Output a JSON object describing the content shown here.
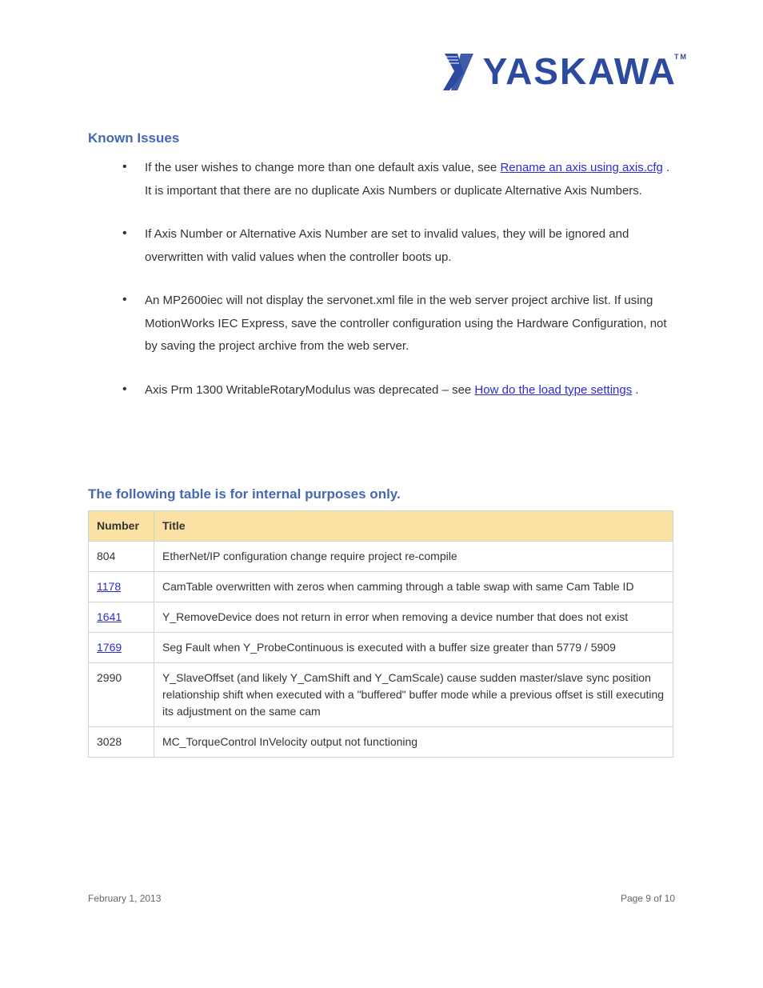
{
  "logo": {
    "text": "YASKAWA",
    "tm": "TM"
  },
  "headings": {
    "known_issues": "Known Issues",
    "table": "The following table is for internal purposes only."
  },
  "bullets": [
    {
      "pre": "If the user wishes to change more than one default axis value, see ",
      "link_text": "Rename an axis using axis.cfg",
      "post": ". It is important that there are no duplicate Axis Numbers or duplicate Alternative Axis Numbers."
    },
    {
      "pre": "If Axis Number or Alternative Axis Number are set to invalid values, they will be ignored and overwritten with valid values when the controller boots up.",
      "link_text": "",
      "post": ""
    },
    {
      "pre": "An MP2600iec will not display the servonet.xml file in the web server project archive list. If using MotionWorks IEC Express, save the controller configuration using the Hardware Configuration, not by saving the project archive from the web server.",
      "link_text": "",
      "post": ""
    },
    {
      "pre": "Axis Prm 1300 WritableRotaryModulus was deprecated – see ",
      "link_text": "How do the load type settings",
      "post": "."
    }
  ],
  "table": {
    "headers": [
      "Number",
      "Title"
    ],
    "rows": [
      {
        "num": "804",
        "num_link": false,
        "title": "EtherNet/IP configuration change require project re-compile"
      },
      {
        "num": "1178",
        "num_link": true,
        "title": "CamTable overwritten with zeros when camming through a table swap with same Cam Table ID"
      },
      {
        "num": "1641",
        "num_link": true,
        "title": "Y_RemoveDevice does not return in error when removing a device number that does not exist"
      },
      {
        "num": "1769",
        "num_link": true,
        "title": "Seg Fault when Y_ProbeContinuous is executed with a buffer size greater than 5779 / 5909"
      },
      {
        "num": "2990",
        "num_link": false,
        "title": "Y_SlaveOffset (and likely Y_CamShift and Y_CamScale) cause sudden master/slave sync position relationship shift when executed with a \"buffered\" buffer mode while a previous offset is still executing its adjustment on the same cam"
      },
      {
        "num": "3028",
        "num_link": false,
        "title": "MC_TorqueControl InVelocity output not functioning"
      }
    ]
  },
  "footer": {
    "left": "February 1, 2013",
    "right": "Page 9 of 10"
  }
}
